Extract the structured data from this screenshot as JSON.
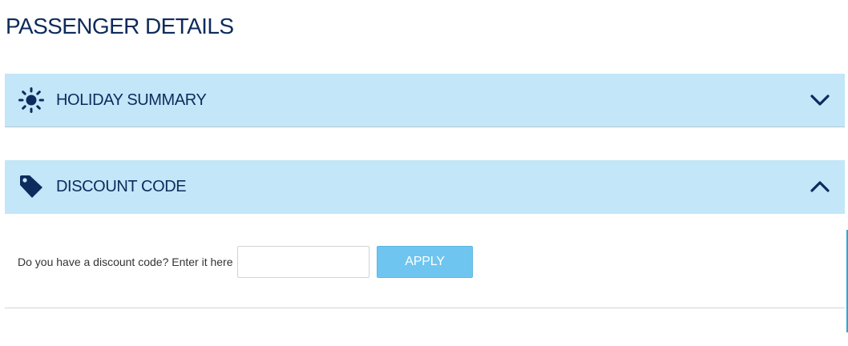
{
  "page": {
    "title": "PASSENGER DETAILS"
  },
  "holiday_summary": {
    "label": "HOLIDAY SUMMARY",
    "icon": "sun-icon",
    "state": "collapsed",
    "chevron": "chevron-down-icon"
  },
  "discount_code": {
    "label": "DISCOUNT CODE",
    "icon": "tag-icon",
    "state": "expanded",
    "chevron": "chevron-up-icon",
    "prompt": "Do you have a discount code? Enter it here",
    "input_value": "",
    "input_placeholder": "",
    "apply_label": "APPLY"
  },
  "colors": {
    "primary_text": "#0d2b5c",
    "panel_background": "#c3e6f8",
    "button_background": "#6ec5f0",
    "accent_edge": "#2aa7d9"
  }
}
